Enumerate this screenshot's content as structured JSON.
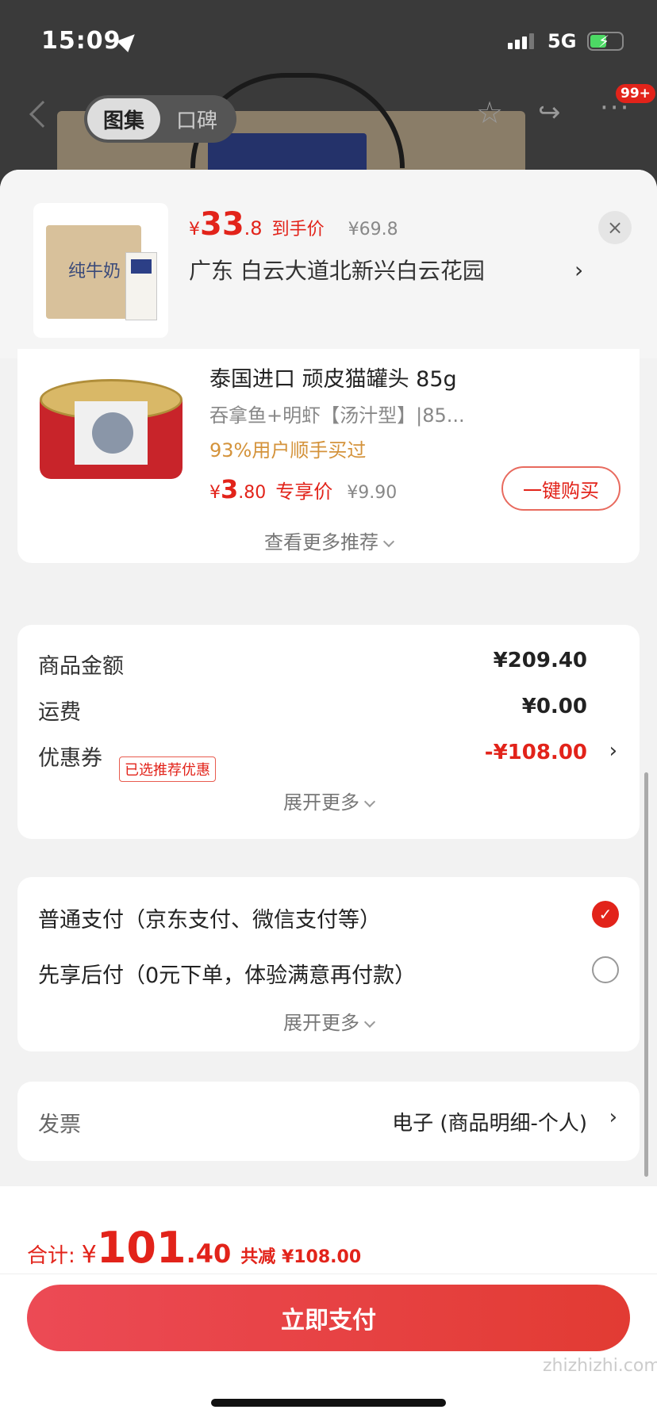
{
  "status": {
    "time": "15:09",
    "network": "5G"
  },
  "nav": {
    "tab_active": "图集",
    "tab_inactive": "口碑",
    "badge": "99+"
  },
  "sheet": {
    "product_price": {
      "currency": "¥",
      "int": "33",
      "dec": ".8",
      "tag": "到手价",
      "original": "¥69.8"
    },
    "address": "广东  白云大道北新兴白云花园",
    "close_label": "×"
  },
  "recommend": {
    "title": "泰国进口 顽皮猫罐头 85g",
    "subtitle": "吞拿鱼+明虾【汤汁型】|85...",
    "hint": "93%用户顺手买过",
    "price": {
      "currency": "¥",
      "int": "3",
      "dec": ".80",
      "tag": "专享价",
      "original": "¥9.90"
    },
    "buy_label": "一键购买",
    "more_label": "查看更多推荐"
  },
  "amounts": {
    "rows": [
      {
        "label": "商品金额",
        "value": "¥209.40"
      },
      {
        "label": "运费",
        "value": "¥0.00"
      },
      {
        "label": "优惠券",
        "tag": "已选推荐优惠",
        "value": "-¥108.00"
      }
    ],
    "more_label": "展开更多"
  },
  "payment": {
    "options": [
      {
        "label": "普通支付（京东支付、微信支付等）",
        "selected": true
      },
      {
        "label": "先享后付（0元下单，体验满意再付款）",
        "selected": false
      }
    ],
    "more_label": "展开更多"
  },
  "invoice": {
    "label": "发票",
    "value": "电子 (商品明细-个人)"
  },
  "footer": {
    "total_label": "合计:",
    "currency": "¥",
    "total_int": "101",
    "total_dec": ".40",
    "saving": "共减 ¥108.00",
    "pay_label": "立即支付"
  },
  "watermark": "zhizhizhi.com",
  "colors": {
    "accent": "#e2231a",
    "coupon_hint": "#d4933b"
  }
}
